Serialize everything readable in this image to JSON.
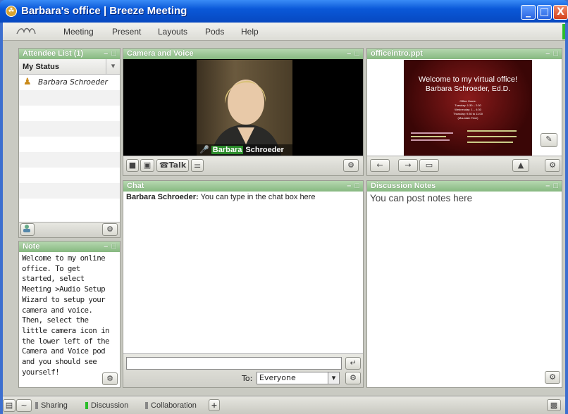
{
  "window": {
    "title": "Barbara's office | Breeze Meeting",
    "minimize": "_",
    "maximize": "□",
    "close": "X"
  },
  "menu": {
    "items": [
      "Meeting",
      "Present",
      "Layouts",
      "Pods",
      "Help"
    ]
  },
  "attendee": {
    "title": "Attendee List (1)",
    "status_label": "My Status",
    "dropdown": "▾",
    "name": "Barbara Schroeder"
  },
  "camera": {
    "title": "Camera and Voice",
    "talk_label": "Talk",
    "caption_first": "Barbara",
    "caption_last": "Schroeder"
  },
  "slide": {
    "title": "officeintro.ppt",
    "heading": "Welcome to my virtual office!",
    "subheading": "Barbara Schroeder, Ed.D.",
    "hours": [
      "Office Hours:",
      "Tuesday: 1:30 – 2:30",
      "Wednesday: 1 – 4:30",
      "Thursday: 9:30 to 11:00",
      "(Mountain Time)"
    ]
  },
  "chat": {
    "title": "Chat",
    "sender": "Barbara Schroeder:",
    "message": "You can type in the chat box here",
    "to_label": "To:",
    "recipient": "Everyone",
    "send": "↵"
  },
  "notes": {
    "title": "Discussion Notes",
    "text": "You can post notes here"
  },
  "note": {
    "title": "Note",
    "text": "Welcome to my online office. To get started, select Meeting >Audio Setup Wizard to setup your camera and voice. Then, select the little camera icon in the lower left of the Camera and Voice pod and you should see yourself!"
  },
  "tabs": {
    "sharing": "Sharing",
    "discussion": "Discussion",
    "collaboration": "Collaboration",
    "add": "+"
  },
  "pod_controls": "– □",
  "colors": {
    "pod_header": "#9ecb98",
    "title_bar": "#0a58d8",
    "active_tab": "#2bbd2b"
  }
}
